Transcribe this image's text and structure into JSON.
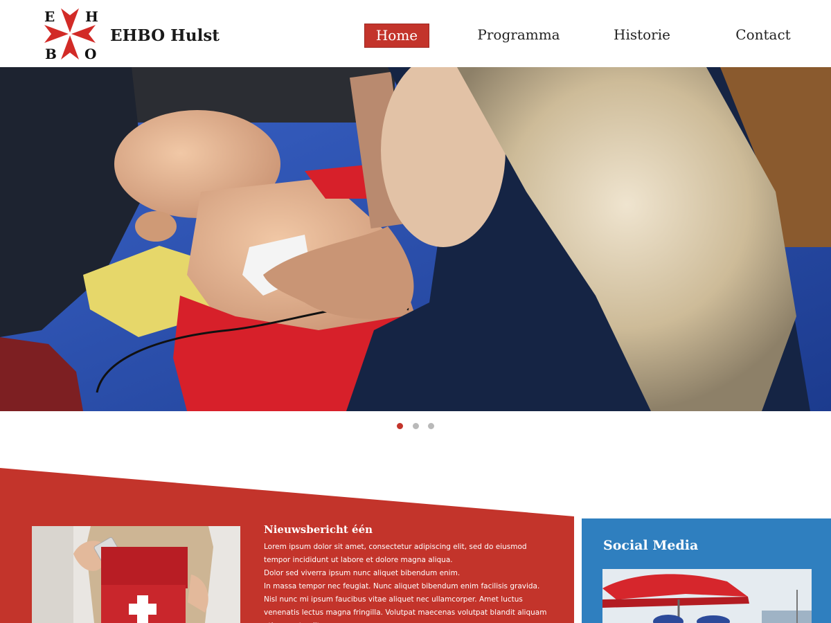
{
  "header": {
    "logo_letters": [
      "E",
      "H",
      "B",
      "O"
    ],
    "brand": "EHBO Hulst",
    "nav": [
      {
        "label": "Home",
        "active": true
      },
      {
        "label": "Programma",
        "active": false
      },
      {
        "label": "Historie",
        "active": false
      },
      {
        "label": "Contact",
        "active": false
      }
    ]
  },
  "carousel": {
    "slide_count": 3,
    "active_index": 0
  },
  "news": {
    "title": "Nieuwsbericht één",
    "paragraphs": [
      "Lorem ipsum dolor sit amet, consectetur adipiscing elit, sed do eiusmod tempor incididunt ut labore et dolore magna aliqua.",
      "Dolor sed viverra ipsum nunc aliquet bibendum enim.",
      "In massa tempor nec feugiat. Nunc aliquet bibendum enim facilisis gravida. Nisl nunc mi ipsum faucibus vitae aliquet nec ullamcorper. Amet luctus venenatis lectus magna fringilla. Volutpat maecenas volutpat blandit aliquam etiam erat velit"
    ]
  },
  "social": {
    "title": "Social Media"
  },
  "colors": {
    "accent_red": "#c3342b",
    "accent_blue": "#2f7fbf"
  }
}
